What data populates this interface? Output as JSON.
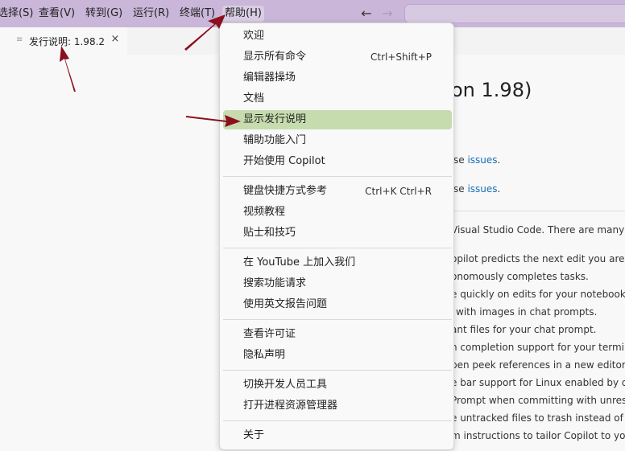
{
  "menubar": {
    "items": [
      "选择(S)",
      "查看(V)",
      "转到(G)",
      "运行(R)",
      "终端(T)",
      "帮助(H)"
    ],
    "back_icon": "arrow-left-icon",
    "forward_icon": "arrow-right-icon"
  },
  "tab": {
    "label": "发行说明: 1.98.2",
    "icon": "document-icon",
    "close": "×"
  },
  "document": {
    "title": "on 1.98)",
    "lines": [
      {
        "prefix": "se ",
        "link": "issues",
        "suffix": "."
      },
      {
        "prefix": "se ",
        "link": "issues",
        "suffix": "."
      },
      {
        "text": "Visual Studio Code. There are many up"
      },
      {
        "text": "opilot predicts the next edit you are l"
      },
      {
        "text": "onomously completes tasks."
      },
      {
        "text": "e quickly on edits for your notebooks."
      },
      {
        "text": "with images in chat prompts."
      },
      {
        "text": "ant files for your chat prompt."
      },
      {
        "text": "h completion support for your termin"
      },
      {
        "text": "pen peek references in a new editor."
      },
      {
        "text": "e bar support for Linux enabled by de"
      },
      {
        "text": "Prompt when committing with unreso"
      },
      {
        "text": "e untracked files to trash instead of d"
      },
      {
        "text": "m instructions to tailor Copilot to you"
      }
    ]
  },
  "help_menu": {
    "groups": [
      [
        {
          "label": "欢迎",
          "shortcut": ""
        },
        {
          "label": "显示所有命令",
          "shortcut": "Ctrl+Shift+P"
        },
        {
          "label": "编辑器操场",
          "shortcut": ""
        },
        {
          "label": "文档",
          "shortcut": ""
        },
        {
          "label": "显示发行说明",
          "shortcut": ""
        },
        {
          "label": "辅助功能入门",
          "shortcut": ""
        },
        {
          "label": "开始使用 Copilot",
          "shortcut": ""
        }
      ],
      [
        {
          "label": "键盘快捷方式参考",
          "shortcut": "Ctrl+K Ctrl+R"
        },
        {
          "label": "视频教程",
          "shortcut": ""
        },
        {
          "label": "贴士和技巧",
          "shortcut": ""
        }
      ],
      [
        {
          "label": "在 YouTube 上加入我们",
          "shortcut": ""
        },
        {
          "label": "搜索功能请求",
          "shortcut": ""
        },
        {
          "label": "使用英文报告问题",
          "shortcut": ""
        }
      ],
      [
        {
          "label": "查看许可证",
          "shortcut": ""
        },
        {
          "label": "隐私声明",
          "shortcut": ""
        }
      ],
      [
        {
          "label": "切换开发人员工具",
          "shortcut": ""
        },
        {
          "label": "打开进程资源管理器",
          "shortcut": ""
        }
      ],
      [
        {
          "label": "关于",
          "shortcut": ""
        }
      ]
    ],
    "highlighted": "显示发行说明"
  },
  "colors": {
    "menubar_bg": "#c9b6d8",
    "highlight_bg": "#c6dcae",
    "link": "#1a6fb5",
    "arrow": "#8b0f1f"
  }
}
